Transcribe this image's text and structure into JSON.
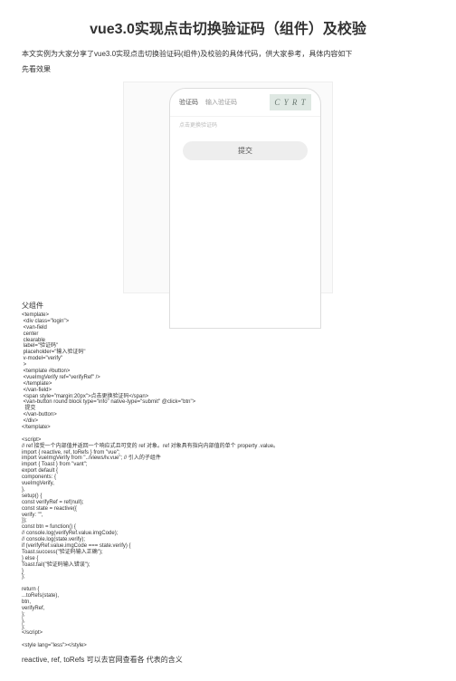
{
  "title": "vue3.0实现点击切换验证码（组件）及校验",
  "intro": "本文实例为大家分享了vue3.0实现点击切换验证码(组件)及校验的具体代码，供大家参考，具体内容如下",
  "sub": "先看效果",
  "shot": {
    "field_label": "验证码",
    "placeholder": "输入验证码",
    "captcha": "C Y R T",
    "switch": "点击更换验证码",
    "submit": "提交"
  },
  "section_parent": "父组件",
  "code": "<template>\n <div class=\"login\">\n <van-field\n center\n clearable\n label=\"验证码\"\n placeholder=\"输入验证码\"\n v-model=\"verify\"\n >\n <template #button>\n <vueImgVerify ref=\"verifyRef\" />\n </template>\n </van-field>\n <span style=\"margin:20px\">点击更换验证码</span>\n <van-button round block type=\"info\" native-type=\"submit\" @click=\"btn\">\n  提交\n </van-button>\n </div>\n</template>\n\n<script>\n// ref 接受一个内部值并返回一个响应式且可变的 ref 对象。ref 对象具有指向内部值的单个 property .value。\nimport { reactive, ref, toRefs } from \"vue\";\nimport vueImgVerify from \"../views/lv.vue\"; // 引入的子组件\nimport { Toast } from \"vant\";\nexport default {\ncomponents: {\nvueImgVerify,\n},\nsetup() {\nconst verifyRef = ref(null);\nconst state = reactive({\nverify: \"\",\n});\nconst btn = function() {\n// console.log(verifyRef.value.imgCode);\n// console.log(state.verify);\nif (verifyRef.value.imgCode === state.verify) {\nToast.success(\"验证码输入正确\");\n} else {\nToast.fail(\"验证码输入错误\");\n}\n};\n\nreturn {\n...toRefs(state),\nbtn,\nverifyRef,\n};\n},\n};\n</script>\n\n<style lang=\"less\"></style>",
  "note": "reactive, ref, toRefs 可以去官网查看各 代表的含义"
}
